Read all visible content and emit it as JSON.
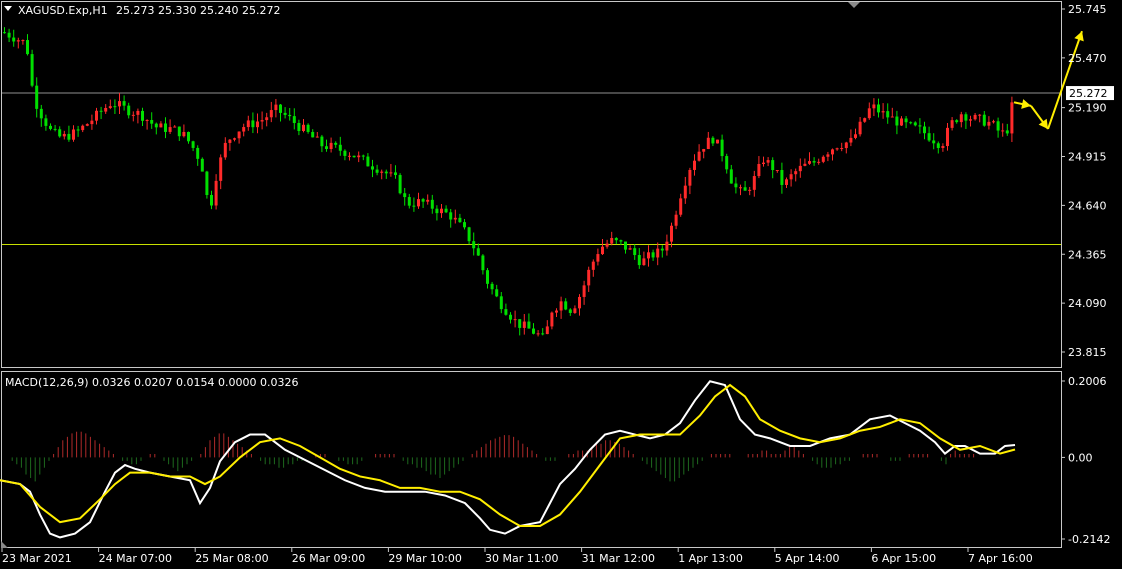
{
  "header": {
    "symbol": "XAGUSD.Exp,H1",
    "ohlc": "25.273 25.330 25.240 25.272"
  },
  "macd_header": {
    "label": "MACD(12,26,9) 0.0326 0.0207 0.0154 0.0000 0.0326"
  },
  "colors": {
    "background": "#000000",
    "bull": "#ff2a2a",
    "bear": "#00e000",
    "support_line": "#c8e000",
    "price_line": "#8f8f8f",
    "macd_line": "#ffffff",
    "signal_line": "#ffee00",
    "hist_pos": "#b02a2a",
    "hist_neg": "#1e6a1e",
    "arrow": "#ffee00"
  },
  "chart_data": [
    {
      "type": "candlestick",
      "title": "XAGUSD.Exp,H1",
      "y_ticks": [
        "25.745",
        "25.470",
        "25.190",
        "24.915",
        "24.640",
        "24.365",
        "24.090",
        "23.815"
      ],
      "ylim": [
        23.7,
        25.78
      ],
      "current_price": "25.272",
      "horizontal_lines": [
        25.272,
        24.42
      ],
      "x_ticks": [
        "23 Mar 2021",
        "24 Mar 07:00",
        "25 Mar 08:00",
        "26 Mar 09:00",
        "29 Mar 10:00",
        "30 Mar 11:00",
        "31 Mar 12:00",
        "1 Apr 13:00",
        "5 Apr 14:00",
        "6 Apr 15:00",
        "7 Apr 16:00"
      ],
      "close_path": [
        [
          0,
          25.62
        ],
        [
          15,
          25.58
        ],
        [
          25,
          25.55
        ],
        [
          32,
          25.25
        ],
        [
          40,
          25.15
        ],
        [
          50,
          25.05
        ],
        [
          60,
          25.02
        ],
        [
          75,
          25.05
        ],
        [
          90,
          25.12
        ],
        [
          100,
          25.17
        ],
        [
          110,
          25.22
        ],
        [
          125,
          25.18
        ],
        [
          140,
          25.15
        ],
        [
          155,
          25.08
        ],
        [
          170,
          25.07
        ],
        [
          180,
          25.05
        ],
        [
          190,
          24.98
        ],
        [
          200,
          24.88
        ],
        [
          208,
          24.6
        ],
        [
          215,
          24.82
        ],
        [
          225,
          25.0
        ],
        [
          240,
          25.08
        ],
        [
          260,
          25.12
        ],
        [
          275,
          25.18
        ],
        [
          290,
          25.12
        ],
        [
          305,
          25.05
        ],
        [
          320,
          24.98
        ],
        [
          335,
          24.96
        ],
        [
          350,
          24.93
        ],
        [
          365,
          24.88
        ],
        [
          380,
          24.84
        ],
        [
          395,
          24.78
        ],
        [
          405,
          24.65
        ],
        [
          420,
          24.66
        ],
        [
          435,
          24.62
        ],
        [
          450,
          24.58
        ],
        [
          465,
          24.48
        ],
        [
          475,
          24.38
        ],
        [
          485,
          24.22
        ],
        [
          495,
          24.12
        ],
        [
          505,
          24.05
        ],
        [
          515,
          23.98
        ],
        [
          525,
          23.95
        ],
        [
          535,
          23.92
        ],
        [
          543,
          23.88
        ],
        [
          550,
          24.05
        ],
        [
          560,
          24.1
        ],
        [
          570,
          24.05
        ],
        [
          580,
          24.15
        ],
        [
          588,
          24.28
        ],
        [
          598,
          24.4
        ],
        [
          610,
          24.44
        ],
        [
          620,
          24.42
        ],
        [
          630,
          24.38
        ],
        [
          640,
          24.32
        ],
        [
          650,
          24.36
        ],
        [
          660,
          24.38
        ],
        [
          670,
          24.52
        ],
        [
          680,
          24.72
        ],
        [
          690,
          24.88
        ],
        [
          700,
          24.97
        ],
        [
          712,
          25.02
        ],
        [
          722,
          24.92
        ],
        [
          732,
          24.75
        ],
        [
          742,
          24.7
        ],
        [
          752,
          24.78
        ],
        [
          762,
          24.9
        ],
        [
          772,
          24.85
        ],
        [
          782,
          24.75
        ],
        [
          792,
          24.82
        ],
        [
          802,
          24.86
        ],
        [
          812,
          24.88
        ],
        [
          822,
          24.93
        ],
        [
          835,
          24.98
        ],
        [
          850,
          25.0
        ],
        [
          860,
          25.1
        ],
        [
          870,
          25.2
        ],
        [
          880,
          25.16
        ],
        [
          890,
          25.13
        ],
        [
          900,
          25.1
        ],
        [
          910,
          25.08
        ],
        [
          920,
          25.06
        ],
        [
          930,
          25.02
        ],
        [
          940,
          24.98
        ],
        [
          950,
          25.1
        ],
        [
          960,
          25.16
        ],
        [
          970,
          25.13
        ],
        [
          980,
          25.12
        ],
        [
          990,
          25.1
        ],
        [
          1000,
          25.04
        ],
        [
          1008,
          25.08
        ],
        [
          1012,
          25.27
        ]
      ],
      "arrows": [
        {
          "from": [
            1014,
            25.22
          ],
          "to": [
            1031,
            25.2
          ]
        },
        {
          "from": [
            1031,
            25.2
          ],
          "to": [
            1048,
            25.07
          ]
        },
        {
          "from": [
            1048,
            25.07
          ],
          "to": [
            1082,
            25.62
          ]
        }
      ]
    },
    {
      "type": "line",
      "title": "MACD(12,26,9)",
      "y_ticks": [
        "0.2006",
        "0.00",
        "-0.2142"
      ],
      "ylim": [
        -0.2142,
        0.2006
      ],
      "series": [
        {
          "name": "MACD",
          "x": [
            0,
            20,
            30,
            40,
            50,
            60,
            75,
            90,
            105,
            115,
            125,
            135,
            150,
            170,
            190,
            200,
            210,
            220,
            235,
            250,
            265,
            285,
            300,
            315,
            330,
            345,
            365,
            385,
            405,
            425,
            445,
            465,
            480,
            490,
            505,
            520,
            540,
            550,
            560,
            575,
            590,
            605,
            620,
            635,
            650,
            665,
            680,
            695,
            710,
            725,
            740,
            755,
            770,
            790,
            810,
            830,
            850,
            870,
            890,
            905,
            920,
            935,
            945,
            955,
            965,
            980,
            995,
            1005,
            1015
          ],
          "values": [
            -0.06,
            -0.07,
            -0.09,
            -0.15,
            -0.2,
            -0.21,
            -0.2,
            -0.17,
            -0.09,
            -0.04,
            -0.02,
            -0.03,
            -0.04,
            -0.05,
            -0.06,
            -0.12,
            -0.08,
            -0.01,
            0.04,
            0.06,
            0.06,
            0.02,
            0.0,
            -0.02,
            -0.04,
            -0.06,
            -0.08,
            -0.09,
            -0.09,
            -0.09,
            -0.1,
            -0.12,
            -0.16,
            -0.19,
            -0.2,
            -0.18,
            -0.17,
            -0.12,
            -0.07,
            -0.03,
            0.02,
            0.06,
            0.07,
            0.06,
            0.05,
            0.06,
            0.09,
            0.15,
            0.2,
            0.19,
            0.1,
            0.06,
            0.05,
            0.03,
            0.03,
            0.05,
            0.06,
            0.1,
            0.11,
            0.09,
            0.07,
            0.04,
            0.01,
            0.03,
            0.03,
            0.01,
            0.01,
            0.03,
            0.0326
          ]
        },
        {
          "name": "Signal",
          "x": [
            0,
            20,
            40,
            60,
            80,
            100,
            115,
            130,
            150,
            170,
            190,
            205,
            220,
            240,
            260,
            280,
            300,
            320,
            340,
            360,
            380,
            400,
            420,
            440,
            460,
            480,
            500,
            520,
            540,
            560,
            580,
            600,
            620,
            640,
            660,
            680,
            700,
            715,
            730,
            745,
            760,
            780,
            800,
            820,
            840,
            860,
            880,
            900,
            920,
            940,
            960,
            980,
            1000,
            1015
          ],
          "values": [
            -0.06,
            -0.07,
            -0.13,
            -0.17,
            -0.16,
            -0.11,
            -0.07,
            -0.04,
            -0.04,
            -0.05,
            -0.05,
            -0.07,
            -0.05,
            0.0,
            0.04,
            0.05,
            0.03,
            0.0,
            -0.03,
            -0.05,
            -0.06,
            -0.08,
            -0.08,
            -0.09,
            -0.09,
            -0.11,
            -0.15,
            -0.18,
            -0.18,
            -0.15,
            -0.09,
            -0.02,
            0.05,
            0.06,
            0.06,
            0.06,
            0.11,
            0.16,
            0.19,
            0.16,
            0.1,
            0.07,
            0.05,
            0.04,
            0.05,
            0.07,
            0.08,
            0.1,
            0.09,
            0.05,
            0.02,
            0.03,
            0.01,
            0.0207
          ]
        }
      ],
      "histogram": {
        "x_start": 3,
        "x_step": 4.6,
        "values": [
          0.0,
          0.0,
          -0.01,
          -0.02,
          -0.03,
          -0.05,
          -0.06,
          -0.07,
          -0.05,
          -0.03,
          -0.01,
          0.01,
          0.03,
          0.05,
          0.06,
          0.07,
          0.075,
          0.075,
          0.07,
          0.06,
          0.05,
          0.04,
          0.03,
          0.02,
          0.01,
          0.0,
          -0.01,
          -0.01,
          -0.02,
          -0.02,
          -0.01,
          0.0,
          0.01,
          0.01,
          0.0,
          -0.01,
          -0.02,
          -0.03,
          -0.04,
          -0.03,
          -0.02,
          -0.01,
          0.0,
          0.01,
          0.03,
          0.05,
          0.06,
          0.07,
          0.07,
          0.06,
          0.05,
          0.04,
          0.03,
          0.02,
          0.01,
          0.0,
          -0.01,
          -0.02,
          -0.02,
          -0.02,
          -0.03,
          -0.03,
          -0.02,
          -0.02,
          -0.01,
          -0.01,
          0.0,
          0.0,
          0.01,
          0.01,
          0.01,
          0.0,
          0.0,
          -0.01,
          -0.01,
          -0.02,
          -0.02,
          -0.02,
          -0.01,
          0.0,
          0.0,
          0.01,
          0.01,
          0.01,
          0.01,
          0.01,
          0.0,
          -0.01,
          -0.02,
          -0.02,
          -0.03,
          -0.03,
          -0.04,
          -0.05,
          -0.05,
          -0.06,
          -0.05,
          -0.04,
          -0.03,
          -0.02,
          -0.01,
          0.0,
          0.01,
          0.02,
          0.03,
          0.04,
          0.05,
          0.055,
          0.06,
          0.065,
          0.065,
          0.06,
          0.05,
          0.04,
          0.03,
          0.02,
          0.01,
          0.0,
          -0.01,
          -0.01,
          -0.01,
          0.0,
          0.0,
          0.01,
          0.01,
          0.02,
          0.02,
          0.02,
          0.03,
          0.04,
          0.04,
          0.05,
          0.05,
          0.045,
          0.04,
          0.03,
          0.02,
          0.01,
          0.0,
          -0.01,
          -0.02,
          -0.03,
          -0.04,
          -0.05,
          -0.06,
          -0.07,
          -0.07,
          -0.06,
          -0.05,
          -0.04,
          -0.03,
          -0.02,
          -0.01,
          0.0,
          0.01,
          0.01,
          0.01,
          0.01,
          0.01,
          0.0,
          0.0,
          0.0,
          0.01,
          0.01,
          0.01,
          0.02,
          0.02,
          0.01,
          0.01,
          0.01,
          0.02,
          0.03,
          0.03,
          0.02,
          0.01,
          0.0,
          -0.01,
          -0.02,
          -0.03,
          -0.03,
          -0.03,
          -0.02,
          -0.02,
          -0.01,
          -0.01,
          0.0,
          0.0,
          0.01,
          0.01,
          0.01,
          0.01,
          0.0,
          0.0,
          -0.01,
          -0.01,
          -0.01,
          0.0,
          0.01,
          0.01,
          0.01,
          0.01,
          0.01,
          0.0,
          0.0,
          -0.01,
          -0.02,
          0.01,
          0.02,
          0.01,
          0.01,
          0.01,
          0.01
        ]
      }
    }
  ]
}
